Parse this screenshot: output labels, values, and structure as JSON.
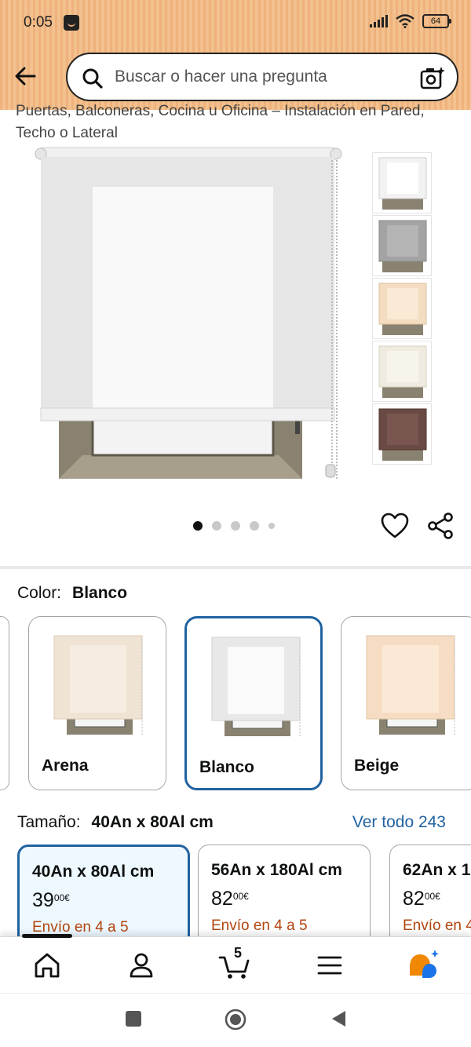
{
  "status_bar": {
    "time": "0:05",
    "battery": "64"
  },
  "search": {
    "placeholder": "Buscar o hacer una pregunta"
  },
  "product": {
    "title_partial": "Puertas, Balconeras, Cocina u Oficina – Instalación en Pared, Techo o Lateral",
    "image_dots": 5,
    "active_image": 0
  },
  "color": {
    "label": "Color:",
    "selected": "Blanco",
    "options": [
      {
        "label": "Arena",
        "fabric": "#efe3d4"
      },
      {
        "label": "Blanco",
        "fabric": "#f4f4f4"
      },
      {
        "label": "Beige",
        "fabric": "#f6e0c8"
      }
    ]
  },
  "thumbnails": [
    {
      "name": "white",
      "fabric": "#f2f2f2"
    },
    {
      "name": "grey",
      "fabric": "#a3a3a3"
    },
    {
      "name": "beige",
      "fabric": "#f3dcc0"
    },
    {
      "name": "cream",
      "fabric": "#efebe0"
    },
    {
      "name": "brown",
      "fabric": "#6a4a44"
    }
  ],
  "size": {
    "label": "Tamaño:",
    "selected": "40An x 80Al cm",
    "see_all": "Ver todo 243",
    "options": [
      {
        "title": "40An x 80Al cm",
        "price_int": "39",
        "price_dec": "00",
        "currency": "€",
        "shipping": "Envío en 4 a 5"
      },
      {
        "title": "56An x 180Al cm",
        "price_int": "82",
        "price_dec": "00",
        "currency": "€",
        "shipping": "Envío en 4 a 5"
      },
      {
        "title": "62An x 1",
        "price_int": "82",
        "price_dec": "00",
        "currency": "€",
        "shipping": "Envío en 4"
      }
    ]
  },
  "bottom_nav": {
    "cart_count": "5"
  },
  "colors": {
    "accent_blue": "#2162a1",
    "shipping_orange": "#b1450e",
    "header_orange": "#f3c18e"
  }
}
